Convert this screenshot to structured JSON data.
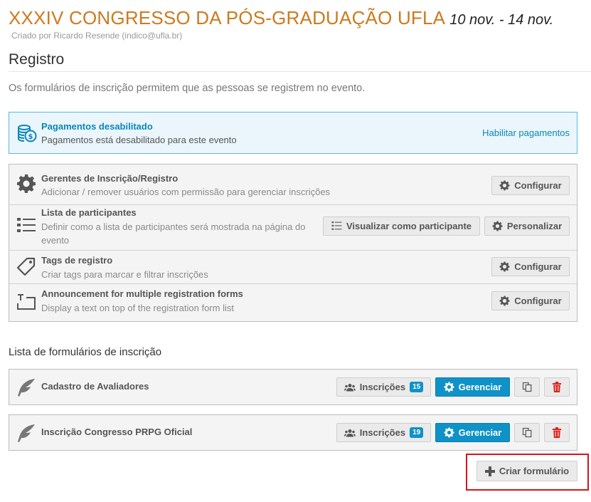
{
  "header": {
    "title": "XXXIV CONGRESSO DA PÓS-GRADUAÇÃO UFLA",
    "dates": "10 nov. - 14 nov.",
    "created_by": "Criado por Ricardo Resende (indico@ufla.br)"
  },
  "section": {
    "title": "Registro",
    "description": "Os formulários de inscrição permitem que as pessoas se registrem no evento."
  },
  "payments": {
    "title": "Pagamentos desabilitado",
    "subtitle": "Pagamentos está desabilitado para este evento",
    "link": "Habilitar pagamentos"
  },
  "settings": [
    {
      "title": "Gerentes de Inscrição/Registro",
      "subtitle": "Adicionar / remover usuários com permissão para gerenciar inscrições",
      "buttons": [
        "Configurar"
      ]
    },
    {
      "title": "Lista de participantes",
      "subtitle": "Definir como a lista de participantes será mostrada na página do evento",
      "buttons": [
        "Visualizar como participante",
        "Personalizar"
      ]
    },
    {
      "title": "Tags de registro",
      "subtitle": "Criar tags para marcar e filtrar inscrições",
      "buttons": [
        "Configurar"
      ]
    },
    {
      "title": "Announcement for multiple registration forms",
      "subtitle": "Display a text on top of the registration form list",
      "buttons": [
        "Configurar"
      ]
    }
  ],
  "forms_list": {
    "title": "Lista de formulários de inscrição",
    "registrations_label": "Inscrições",
    "manage_label": "Gerenciar",
    "forms": [
      {
        "name": "Cadastro de Avaliadores",
        "count": "15"
      },
      {
        "name": "Inscrição Congresso PRPG Oficial",
        "count": "19"
      }
    ],
    "create_label": "Criar formulário"
  },
  "colors": {
    "title_orange": "#cc7a1f",
    "accent_blue": "#0e92c8",
    "delete_red": "#d9241c",
    "highlight_red": "#d7141a"
  }
}
